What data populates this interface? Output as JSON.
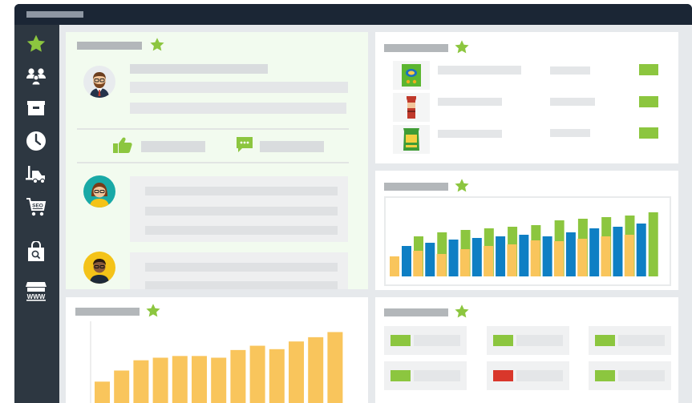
{
  "colors": {
    "window_frame": "#1e2a38",
    "sidebar": "#2d3741",
    "content_bg": "#e6e9ec",
    "accent_green": "#8cc63f",
    "alert_red": "#d9372b",
    "bar_orange": "#f9c55c",
    "bar_blue": "#0e7fc4",
    "placeholder": "#e4e6e8"
  },
  "sidebar": {
    "items": [
      {
        "icon": "star-icon",
        "active": true
      },
      {
        "icon": "users-icon"
      },
      {
        "icon": "box-icon"
      },
      {
        "icon": "clock-icon"
      },
      {
        "icon": "forklift-icon"
      },
      {
        "icon": "seo-cart-icon",
        "label": "SEO"
      },
      {
        "icon": "search-bag-icon"
      },
      {
        "icon": "www-store-icon",
        "label": "WWW"
      }
    ]
  },
  "widgets": {
    "feed": {
      "icons": [
        "star-icon",
        "thumbs-up-icon",
        "comment-icon"
      ]
    },
    "products": {
      "icons": [
        "star-icon"
      ],
      "rows": 3
    },
    "grouped_chart": {
      "icons": [
        "star-icon"
      ]
    },
    "bottom_chart": {
      "icons": [
        "star-icon"
      ]
    },
    "status_tiles": {
      "icons": [
        "star-icon"
      ],
      "tiles": [
        {
          "status": "ok"
        },
        {
          "status": "ok"
        },
        {
          "status": "ok"
        },
        {
          "status": "ok"
        },
        {
          "status": "alert"
        },
        {
          "status": "ok"
        }
      ]
    }
  },
  "chart_data": [
    {
      "type": "bar",
      "series": [
        {
          "color": "#f9c55c",
          "values": [
            25,
            32,
            28,
            34,
            38,
            40,
            45,
            44,
            47,
            50,
            52
          ]
        },
        {
          "color": "#0e7fc4",
          "values": [
            38,
            42,
            46,
            48,
            50,
            52,
            50,
            55,
            60,
            62,
            66
          ]
        },
        {
          "color": "#8cc63f",
          "values": [
            50,
            55,
            58,
            60,
            62,
            64,
            70,
            72,
            74,
            76,
            80
          ]
        }
      ],
      "ylim": [
        0,
        90
      ]
    },
    {
      "type": "bar",
      "values": [
        25,
        38,
        50,
        53,
        55,
        55,
        53,
        62,
        67,
        63,
        72,
        77,
        83
      ],
      "ylim": [
        0,
        90
      ]
    }
  ]
}
